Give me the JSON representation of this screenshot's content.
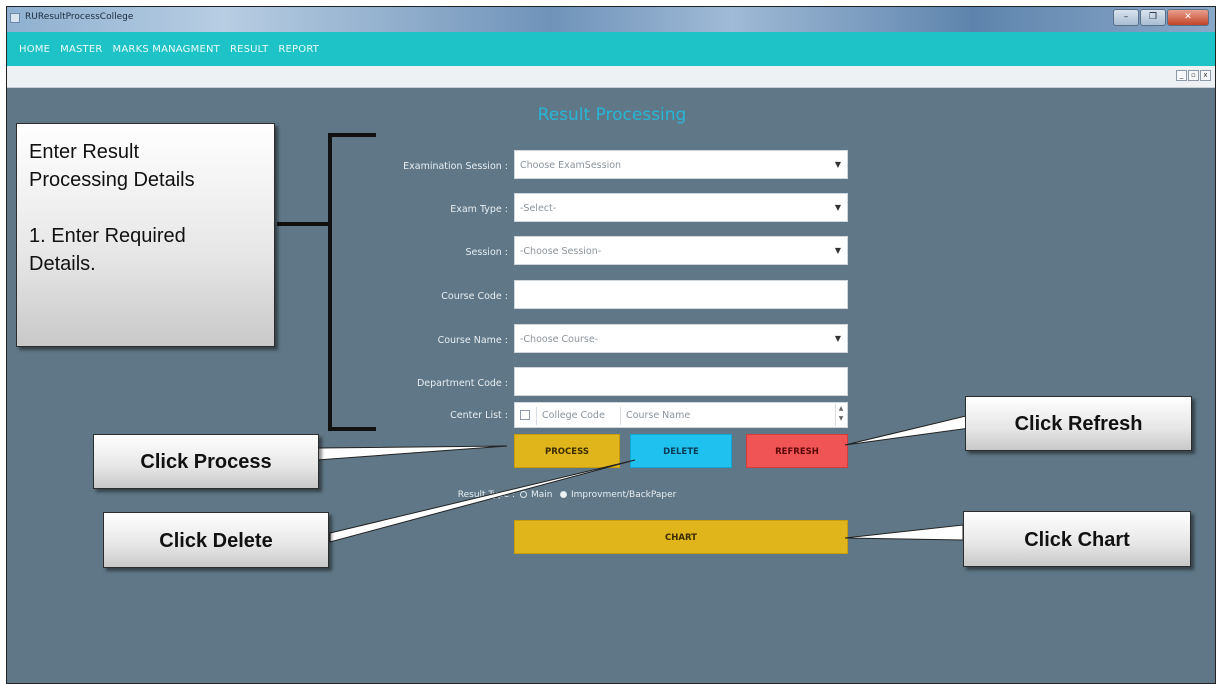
{
  "window": {
    "title": "RUResultProcessCollege",
    "controls": [
      "–",
      "❐",
      "✕"
    ]
  },
  "menu": [
    "HOME",
    "MASTER",
    "MARKS MANAGMENT",
    "RESULT",
    "REPORT"
  ],
  "mdi_controls": [
    "_",
    "▫",
    "x"
  ],
  "form": {
    "title": "Result Processing",
    "fields": [
      {
        "label": "Examination Session :",
        "placeholder": "Choose ExamSession",
        "dropdown": true
      },
      {
        "label": "Exam Type :",
        "placeholder": "-Select-",
        "dropdown": true
      },
      {
        "label": "Session :",
        "placeholder": "-Choose Session-",
        "dropdown": true
      },
      {
        "label": "Course Code :",
        "placeholder": "",
        "dropdown": false
      },
      {
        "label": "Course Name :",
        "placeholder": "-Choose Course-",
        "dropdown": true
      },
      {
        "label": "Department Code :",
        "placeholder": "",
        "dropdown": false
      }
    ],
    "center_list": {
      "label": "Center List :",
      "columns": [
        "College Code",
        "Course Name"
      ]
    },
    "buttons": {
      "process": "PROCESS",
      "delete": "DELETE",
      "refresh": "REFRESH",
      "chart": "CHART"
    },
    "result_type": {
      "label": "Result Type :",
      "options": [
        "Main",
        "Improvment/BackPaper"
      ],
      "selected": "Improvment/BackPaper"
    }
  },
  "callouts": {
    "details": [
      "Enter Result",
      "Processing Details",
      "",
      "1. Enter Required",
      "Details."
    ],
    "process": "Click Process",
    "delete": "Click Delete",
    "refresh": "Click Refresh",
    "chart": "Click Chart"
  },
  "colors": {
    "menubar": "#1ec3c8",
    "background": "#5f7786",
    "title": "#27b7d6",
    "process": "#e0b51c",
    "delete": "#1fc2ef",
    "refresh": "#f05454",
    "chart": "#e0b51c"
  }
}
